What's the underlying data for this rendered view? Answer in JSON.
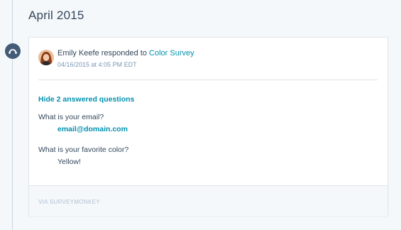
{
  "timeline": {
    "month": "April 2015"
  },
  "event": {
    "icon": "survey-icon",
    "actor": "Emily Keefe",
    "verb": "responded to",
    "survey_link": "Color Survey",
    "timestamp": "04/16/2015 at 4:05 PM EDT",
    "toggle_label": "Hide 2 answered questions",
    "questions": [
      {
        "question": "What is your email?",
        "answer": "email@domain.com",
        "answer_is_link": true
      },
      {
        "question": "What is your favorite color?",
        "answer": "Yellow!",
        "answer_is_link": false
      }
    ],
    "source": "VIA SURVEYMONKEY"
  },
  "colors": {
    "accent": "#0091ae",
    "text": "#33475b",
    "marker": "#425b76",
    "background": "#f5f8fa"
  }
}
